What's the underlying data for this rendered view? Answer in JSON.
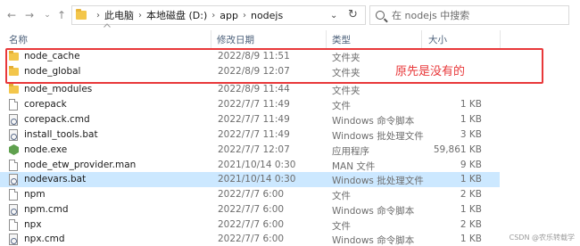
{
  "address_bar": {
    "breadcrumbs": [
      "此电脑",
      "本地磁盘 (D:)",
      "app",
      "nodejs"
    ]
  },
  "search": {
    "placeholder": "在 nodejs 中搜索"
  },
  "columns": {
    "name": "名称",
    "date": "修改日期",
    "type": "类型",
    "size": "大小"
  },
  "files": [
    {
      "name": "node_cache",
      "date": "2022/8/9 11:51",
      "type": "文件夹",
      "size": "",
      "icon": "folder-icon"
    },
    {
      "name": "node_global",
      "date": "2022/8/9 12:07",
      "type": "文件夹",
      "size": "",
      "icon": "folder-icon"
    },
    {
      "name": "node_modules",
      "date": "2022/8/9 11:44",
      "type": "文件夹",
      "size": "",
      "icon": "folder-icon"
    },
    {
      "name": "corepack",
      "date": "2022/7/7 11:49",
      "type": "文件",
      "size": "1 KB",
      "icon": "file-icon"
    },
    {
      "name": "corepack.cmd",
      "date": "2022/7/7 11:49",
      "type": "Windows 命令脚本",
      "size": "1 KB",
      "icon": "script-icon"
    },
    {
      "name": "install_tools.bat",
      "date": "2022/7/7 11:49",
      "type": "Windows 批处理文件",
      "size": "3 KB",
      "icon": "script-icon"
    },
    {
      "name": "node.exe",
      "date": "2022/7/7 12:07",
      "type": "应用程序",
      "size": "59,861 KB",
      "icon": "node-icon"
    },
    {
      "name": "node_etw_provider.man",
      "date": "2021/10/14 0:30",
      "type": "MAN 文件",
      "size": "9 KB",
      "icon": "file-icon"
    },
    {
      "name": "nodevars.bat",
      "date": "2021/10/14 0:30",
      "type": "Windows 批处理文件",
      "size": "1 KB",
      "icon": "script-icon"
    },
    {
      "name": "npm",
      "date": "2022/7/7 6:00",
      "type": "文件",
      "size": "2 KB",
      "icon": "file-icon"
    },
    {
      "name": "npm.cmd",
      "date": "2022/7/7 6:00",
      "type": "Windows 命令脚本",
      "size": "1 KB",
      "icon": "script-icon"
    },
    {
      "name": "npx",
      "date": "2022/7/7 6:00",
      "type": "文件",
      "size": "2 KB",
      "icon": "file-icon"
    },
    {
      "name": "npx.cmd",
      "date": "2022/7/7 6:00",
      "type": "Windows 命令脚本",
      "size": "1 KB",
      "icon": "script-icon"
    }
  ],
  "selected_file": "nodevars.bat",
  "annotation": {
    "text": "原先是没有的",
    "color": "#e8383a"
  },
  "watermark": "CSDN @农乐转载学",
  "colors": {
    "selection": "#cce8ff",
    "header_text": "#4c607a",
    "folder": "#f3c64b"
  }
}
